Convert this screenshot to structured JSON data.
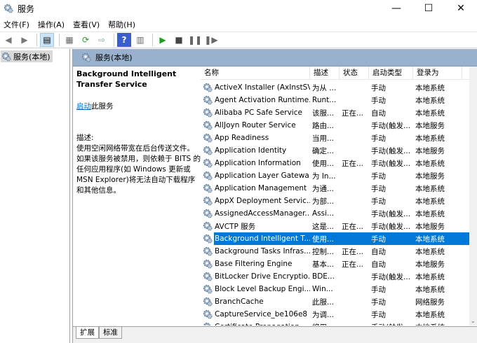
{
  "window": {
    "title": "服务",
    "min": "—",
    "max": "☐",
    "close": "✕"
  },
  "menu": [
    "文件(F)",
    "操作(A)",
    "查看(V)",
    "帮助(H)"
  ],
  "tree": {
    "root": "服务(本地)"
  },
  "pane": {
    "header": "服务(本地)"
  },
  "details": {
    "service_name": "Background Intelligent Transfer Service",
    "start_link": "启动",
    "start_suffix": "此服务",
    "desc_label": "描述:",
    "description": "使用空闲网络带宽在后台传送文件。如果该服务被禁用，则依赖于 BITS 的任何应用程序(如 Windows 更新或 MSN Explorer)将无法自动下载程序和其他信息。"
  },
  "columns": [
    "名称",
    "描述",
    "状态",
    "启动类型",
    "登录为"
  ],
  "rows": [
    [
      "ActiveX Installer (AxInstSV)",
      "为从 ...",
      "",
      "手动",
      "本地系统"
    ],
    [
      "Agent Activation Runtime...",
      "Runt...",
      "",
      "手动",
      "本地系统"
    ],
    [
      "Alibaba PC Safe Service",
      "该服...",
      "正在...",
      "自动",
      "本地系统"
    ],
    [
      "AllJoyn Router Service",
      "路由...",
      "",
      "手动(触发...",
      "本地服务"
    ],
    [
      "App Readiness",
      "当用...",
      "",
      "手动",
      "本地系统"
    ],
    [
      "Application Identity",
      "确定...",
      "",
      "手动(触发...",
      "本地服务"
    ],
    [
      "Application Information",
      "使用...",
      "正在...",
      "手动(触发...",
      "本地系统"
    ],
    [
      "Application Layer Gatewa...",
      "为 In...",
      "",
      "手动",
      "本地服务"
    ],
    [
      "Application Management",
      "为通...",
      "",
      "手动",
      "本地系统"
    ],
    [
      "AppX Deployment Servic...",
      "为部...",
      "",
      "手动",
      "本地系统"
    ],
    [
      "AssignedAccessManager...",
      "Assi...",
      "",
      "手动(触发...",
      "本地系统"
    ],
    [
      "AVCTP 服务",
      "这是...",
      "正在...",
      "手动(触发...",
      "本地服务"
    ],
    [
      "Background Intelligent T...",
      "使用...",
      "",
      "手动",
      "本地系统"
    ],
    [
      "Background Tasks Infras...",
      "控制...",
      "正在...",
      "自动",
      "本地系统"
    ],
    [
      "Base Filtering Engine",
      "基本...",
      "正在...",
      "自动",
      "本地服务"
    ],
    [
      "BitLocker Drive Encryptio...",
      "BDE...",
      "",
      "手动(触发...",
      "本地系统"
    ],
    [
      "Block Level Backup Engi...",
      "Win...",
      "",
      "手动",
      "本地系统"
    ],
    [
      "BranchCache",
      "此服...",
      "",
      "手动",
      "网络服务"
    ],
    [
      "CaptureService_be106e8",
      "为调...",
      "",
      "手动",
      "本地系统"
    ],
    [
      "Certificate Propagation",
      "将用...",
      "",
      "手动(触发...",
      "本地系统"
    ]
  ],
  "selected_index": 12,
  "tabs": [
    "扩展",
    "标准"
  ],
  "colors": {
    "header": "#99b1cc",
    "selection": "#0078d7",
    "link": "#0066cc"
  }
}
